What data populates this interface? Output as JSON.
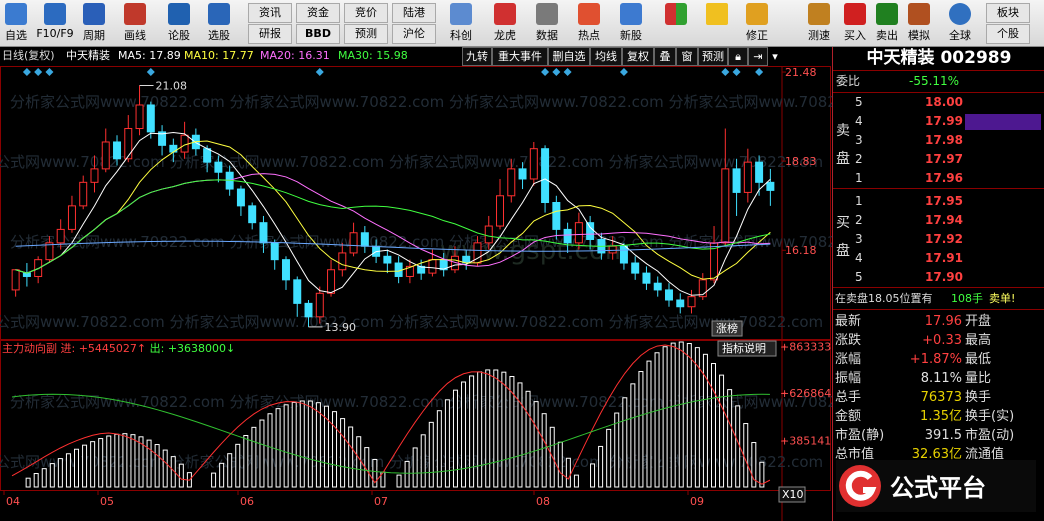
{
  "toolbar": {
    "items": [
      {
        "label": "自选",
        "color": "#3b7bd0"
      },
      {
        "label": "F10/F9",
        "color": "#2c6bc0"
      },
      {
        "label": "周期",
        "color": "#2a5fb8"
      },
      {
        "label": "画线",
        "color": "#c0392b"
      },
      {
        "label": "论股",
        "color": "#2061b0"
      },
      {
        "label": "选股",
        "color": "#2a66b8"
      }
    ],
    "small_top": [
      "资讯",
      "资金",
      "竞价",
      "陆港"
    ],
    "small_bottom": [
      "研报",
      "BBD",
      "预测",
      "沪伦"
    ],
    "items2": [
      {
        "label": "科创",
        "color": "#5c8bd0"
      },
      {
        "label": "龙虎",
        "color": "#d03030"
      },
      {
        "label": "数据",
        "color": "#7a7a7a"
      },
      {
        "label": "热点",
        "color": "#e05030"
      },
      {
        "label": "新股",
        "color": "#3d7ad0"
      }
    ],
    "items3": [
      {
        "label": "修正",
        "color": "#e0a020"
      },
      {
        "label": "测速",
        "color": "#c08020"
      },
      {
        "label": "买入",
        "color": "#d02020"
      },
      {
        "label": "卖出",
        "color": "#208020"
      },
      {
        "label": "模拟",
        "color": "#b05020"
      },
      {
        "label": "全球",
        "color": "#3070c0"
      }
    ],
    "right_top": "板块",
    "right_bottom": "个股"
  },
  "header": {
    "period": "日线(复权)",
    "name": "中天精装",
    "ma5": "MA5: 17.89",
    "ma10": "MA10: 17.77",
    "ma20": "MA20: 16.31",
    "ma30": "MA30: 15.98",
    "tabs": [
      "九转",
      "重大事件",
      "删自选",
      "均线",
      "复权",
      "叠",
      "窗",
      "预测"
    ]
  },
  "chart_data": {
    "type": "candlestick",
    "price_axis": {
      "ticks": [
        "21.48",
        "18.83",
        "16.18"
      ],
      "range": [
        13.6,
        21.6
      ]
    },
    "indicator": {
      "name": "主力动向副",
      "in_label": "进:",
      "in_value": "+5445027",
      "out_label": "出:",
      "out_value": "+3638000",
      "ticks": [
        "+863333",
        "+626864",
        "+385141"
      ],
      "range": [
        150000,
        880000
      ],
      "in_series": [
        300000,
        320000,
        350000,
        380000,
        420000,
        450000,
        480000,
        500000,
        520000,
        540000,
        560000,
        590000,
        610000,
        630000,
        650000,
        670000,
        700000,
        720000,
        740000,
        760000,
        780000,
        800000,
        820000,
        840000,
        860000,
        880000,
        880000,
        860000
      ],
      "out_series": [
        330000,
        360000,
        400000,
        450000,
        500000,
        560000,
        620000,
        680000,
        740000,
        790000,
        830000,
        860000,
        870000,
        860000,
        840000,
        810000,
        780000,
        740000,
        700000,
        660000,
        620000,
        580000,
        540000,
        500000,
        460000,
        420000,
        380000,
        340000
      ]
    },
    "annotations": {
      "high": "21.08",
      "low": "13.90",
      "tag": "涨榜",
      "desc_button": "指标说明",
      "x10": "X10"
    },
    "months": [
      "04",
      "05",
      "06",
      "07",
      "08",
      "09"
    ],
    "candles": [
      [
        15.0,
        15.6,
        14.8,
        15.5
      ],
      [
        15.5,
        15.4,
        15.1,
        15.8
      ],
      [
        15.4,
        15.9,
        15.2,
        16.0
      ],
      [
        15.9,
        16.4,
        15.8,
        16.6
      ],
      [
        16.4,
        16.8,
        16.2,
        17.1
      ],
      [
        16.8,
        17.5,
        16.7,
        17.8
      ],
      [
        17.5,
        18.2,
        17.4,
        18.4
      ],
      [
        18.2,
        18.6,
        17.9,
        19.0
      ],
      [
        18.6,
        19.4,
        18.5,
        19.8
      ],
      [
        19.4,
        18.9,
        18.7,
        19.6
      ],
      [
        18.9,
        19.8,
        18.8,
        20.2
      ],
      [
        19.8,
        20.5,
        19.6,
        21.08
      ],
      [
        20.5,
        19.7,
        19.5,
        20.6
      ],
      [
        19.7,
        19.3,
        19.0,
        19.9
      ],
      [
        19.3,
        19.1,
        18.8,
        19.5
      ],
      [
        19.1,
        19.6,
        18.9,
        20.0
      ],
      [
        19.6,
        19.2,
        19.0,
        19.8
      ],
      [
        19.2,
        18.8,
        18.5,
        19.3
      ],
      [
        18.8,
        18.5,
        18.2,
        19.0
      ],
      [
        18.5,
        18.0,
        17.8,
        18.7
      ],
      [
        18.0,
        17.5,
        17.2,
        18.1
      ],
      [
        17.5,
        17.0,
        16.8,
        17.6
      ],
      [
        17.0,
        16.4,
        16.1,
        17.2
      ],
      [
        16.4,
        15.9,
        15.6,
        16.5
      ],
      [
        15.9,
        15.3,
        15.0,
        16.0
      ],
      [
        15.3,
        14.6,
        14.2,
        15.4
      ],
      [
        14.6,
        14.2,
        13.9,
        14.7
      ],
      [
        14.2,
        14.9,
        14.0,
        15.1
      ],
      [
        14.9,
        15.6,
        14.8,
        15.9
      ],
      [
        15.6,
        16.1,
        15.4,
        16.4
      ],
      [
        16.1,
        16.7,
        16.0,
        17.0
      ],
      [
        16.7,
        16.3,
        16.1,
        16.9
      ],
      [
        16.3,
        16.0,
        15.8,
        16.5
      ],
      [
        16.0,
        15.8,
        15.5,
        16.2
      ],
      [
        15.8,
        15.4,
        15.2,
        16.0
      ],
      [
        15.4,
        15.7,
        15.2,
        15.9
      ],
      [
        15.7,
        15.5,
        15.3,
        15.9
      ],
      [
        15.5,
        15.9,
        15.4,
        16.2
      ],
      [
        15.9,
        15.6,
        15.4,
        16.1
      ],
      [
        15.6,
        16.0,
        15.5,
        16.3
      ],
      [
        16.0,
        15.8,
        15.6,
        16.2
      ],
      [
        15.8,
        16.4,
        15.7,
        16.6
      ],
      [
        16.4,
        16.9,
        16.2,
        17.2
      ],
      [
        16.9,
        17.8,
        16.8,
        18.3
      ],
      [
        17.8,
        18.6,
        17.6,
        18.9
      ],
      [
        18.6,
        18.3,
        18.0,
        18.8
      ],
      [
        18.3,
        19.2,
        18.1,
        19.4
      ],
      [
        19.2,
        17.6,
        17.3,
        19.3
      ],
      [
        17.6,
        16.8,
        16.5,
        17.8
      ],
      [
        16.8,
        16.4,
        16.1,
        17.0
      ],
      [
        16.4,
        17.0,
        16.2,
        17.3
      ],
      [
        17.0,
        16.5,
        16.2,
        17.2
      ],
      [
        16.5,
        16.1,
        15.9,
        16.7
      ],
      [
        16.1,
        16.3,
        15.9,
        16.6
      ],
      [
        16.3,
        15.8,
        15.6,
        16.4
      ],
      [
        15.8,
        15.5,
        15.3,
        16.0
      ],
      [
        15.5,
        15.2,
        15.0,
        15.7
      ],
      [
        15.2,
        15.0,
        14.8,
        15.4
      ],
      [
        15.0,
        14.7,
        14.5,
        15.2
      ],
      [
        14.7,
        14.5,
        14.3,
        14.9
      ],
      [
        14.5,
        14.8,
        14.3,
        15.0
      ],
      [
        14.8,
        15.3,
        14.7,
        15.5
      ],
      [
        15.3,
        16.4,
        15.2,
        16.9
      ],
      [
        16.4,
        18.6,
        16.3,
        19.8
      ],
      [
        18.6,
        17.9,
        17.2,
        18.9
      ],
      [
        17.9,
        18.8,
        17.6,
        19.2
      ],
      [
        18.8,
        18.2,
        17.8,
        19.0
      ],
      [
        18.2,
        17.96,
        17.5,
        18.6
      ]
    ]
  },
  "panel": {
    "title": "中天精装 002989",
    "weibi_label": "委比",
    "weibi_value": "-55.11%",
    "sell_label": "卖盘",
    "buy_label": "买盘",
    "sell": [
      {
        "lvl": "5",
        "price": "18.00"
      },
      {
        "lvl": "4",
        "price": "17.99"
      },
      {
        "lvl": "3",
        "price": "17.98"
      },
      {
        "lvl": "2",
        "price": "17.97"
      },
      {
        "lvl": "1",
        "price": "17.96"
      }
    ],
    "buy": [
      {
        "lvl": "1",
        "price": "17.95"
      },
      {
        "lvl": "2",
        "price": "17.94"
      },
      {
        "lvl": "3",
        "price": "17.92"
      },
      {
        "lvl": "4",
        "price": "17.91"
      },
      {
        "lvl": "5",
        "price": "17.90"
      }
    ],
    "notice_prefix": "在卖盘18.05位置有",
    "notice_qty": "108手",
    "notice_suffix": "卖单!",
    "stats": [
      {
        "l": "最新",
        "v": "17.96",
        "r": "开盘",
        "c": "#ff4040"
      },
      {
        "l": "涨跌",
        "v": "+0.33",
        "r": "最高",
        "c": "#ff4040"
      },
      {
        "l": "涨幅",
        "v": "+1.87%",
        "r": "最低",
        "c": "#ff4040"
      },
      {
        "l": "振幅",
        "v": "8.11%",
        "r": "量比",
        "c": "#e0e0e0"
      },
      {
        "l": "总手",
        "v": "76373",
        "r": "换手",
        "c": "#e8d200"
      },
      {
        "l": "金额",
        "v": "1.35亿",
        "r": "换手(实)",
        "c": "#e8d200"
      },
      {
        "l": "市盈(静)",
        "v": "391.5",
        "r": "市盈(动)",
        "c": "#e0e0e0"
      },
      {
        "l": "总市值",
        "v": "32.63亿",
        "r": "流通值",
        "c": "#e8d200"
      }
    ]
  },
  "logo": {
    "text": "公式平台",
    "url": "www.gspt.com"
  },
  "watermark": "分析家公式网www.70822.com",
  "watermark2": "www.gspt.com"
}
